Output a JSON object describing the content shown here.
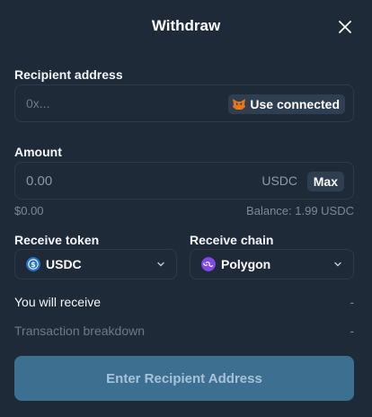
{
  "header": {
    "title": "Withdraw"
  },
  "recipient": {
    "label": "Recipient address",
    "placeholder": "0x...",
    "use_connected_label": "Use connected"
  },
  "amount": {
    "label": "Amount",
    "placeholder": "0.00",
    "unit": "USDC",
    "max_label": "Max",
    "usd_value": "$0.00",
    "balance": "Balance: 1.99 USDC"
  },
  "receive_token": {
    "label": "Receive token",
    "value": "USDC"
  },
  "receive_chain": {
    "label": "Receive chain",
    "value": "Polygon"
  },
  "summary": {
    "you_will_receive_label": "You will receive",
    "you_will_receive_value": "-",
    "breakdown_label": "Transaction breakdown",
    "breakdown_value": "-"
  },
  "cta": {
    "label": "Enter Recipient Address"
  },
  "colors": {
    "background": "#1e2a38",
    "field_border": "#2c3a4b",
    "chip_bg": "#2f3e51",
    "cta_bg": "#3c6f90",
    "usdc_blue": "#2775ca",
    "polygon_purple": "#8247e5"
  },
  "icons": {
    "close": "close-icon",
    "wallet": "metamask-fox-icon",
    "token": "usdc-icon",
    "chain": "polygon-icon",
    "dropdown": "chevron-down-icon"
  }
}
